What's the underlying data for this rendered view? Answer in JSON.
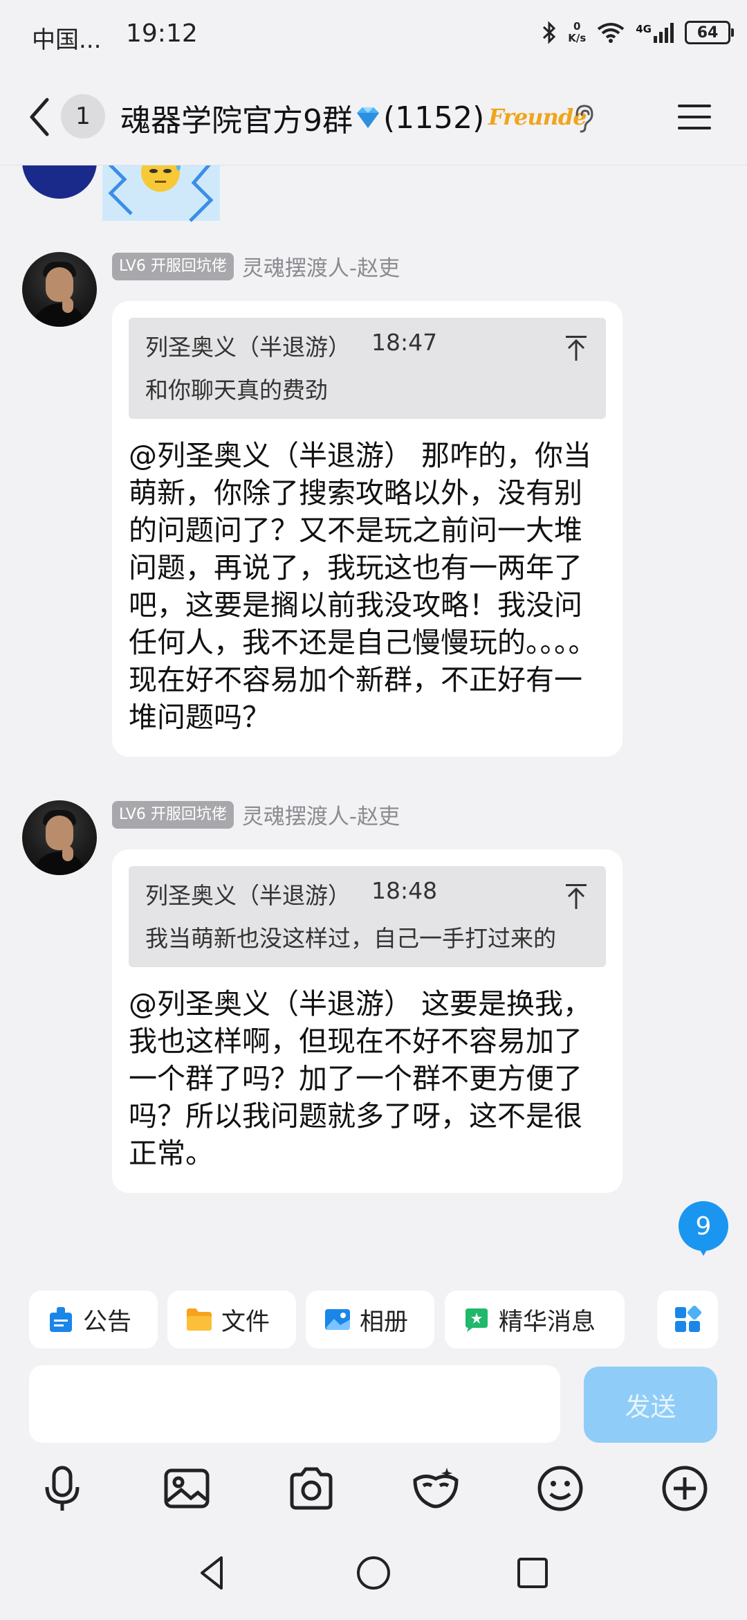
{
  "status_bar": {
    "carrier": "中国...",
    "time": "19:12",
    "speed_value": "0",
    "speed_unit": "K/s",
    "network": "4G",
    "battery": "64"
  },
  "header": {
    "unread_count": "1",
    "title_prefix": "魂器学院官方9群",
    "title_suffix": "(1152)",
    "badge_text": "Freunde"
  },
  "messages": [
    {
      "level": "LV6 开服回坑佬",
      "sender": "灵魂摆渡人-赵吏",
      "quote_author": "列圣奥义（半退游）",
      "quote_time": "18:47",
      "quote_text": "和你聊天真的费劲",
      "text": "@列圣奥义（半退游） 那咋的，你当萌新，你除了搜索攻略以外，没有别的问题问了？又不是玩之前问一大堆问题，再说了，我玩这也有一两年了吧，这要是搁以前我没攻略！我没问任何人，我不还是自己慢慢玩的。。。。现在好不容易加个新群，不正好有一堆问题吗？"
    },
    {
      "level": "LV6 开服回坑佬",
      "sender": "灵魂摆渡人-赵吏",
      "quote_author": "列圣奥义（半退游）",
      "quote_time": "18:48",
      "quote_text": "我当萌新也没这样过，自己一手打过来的",
      "text": "@列圣奥义（半退游） 这要是换我，我也这样啊，但现在不好不容易加了一个群了吗？加了一个群不更方便了吗？所以我问题就多了呀，这不是很正常。"
    }
  ],
  "unread_float": "9",
  "quick_actions": {
    "announcement": "公告",
    "files": "文件",
    "album": "相册",
    "essence": "精华消息"
  },
  "input": {
    "value": "",
    "placeholder": ""
  },
  "send_label": "发送",
  "colors": {
    "accent": "#1a96f0",
    "send_disabled": "#8fcdf8",
    "background": "#f2f2f5"
  }
}
